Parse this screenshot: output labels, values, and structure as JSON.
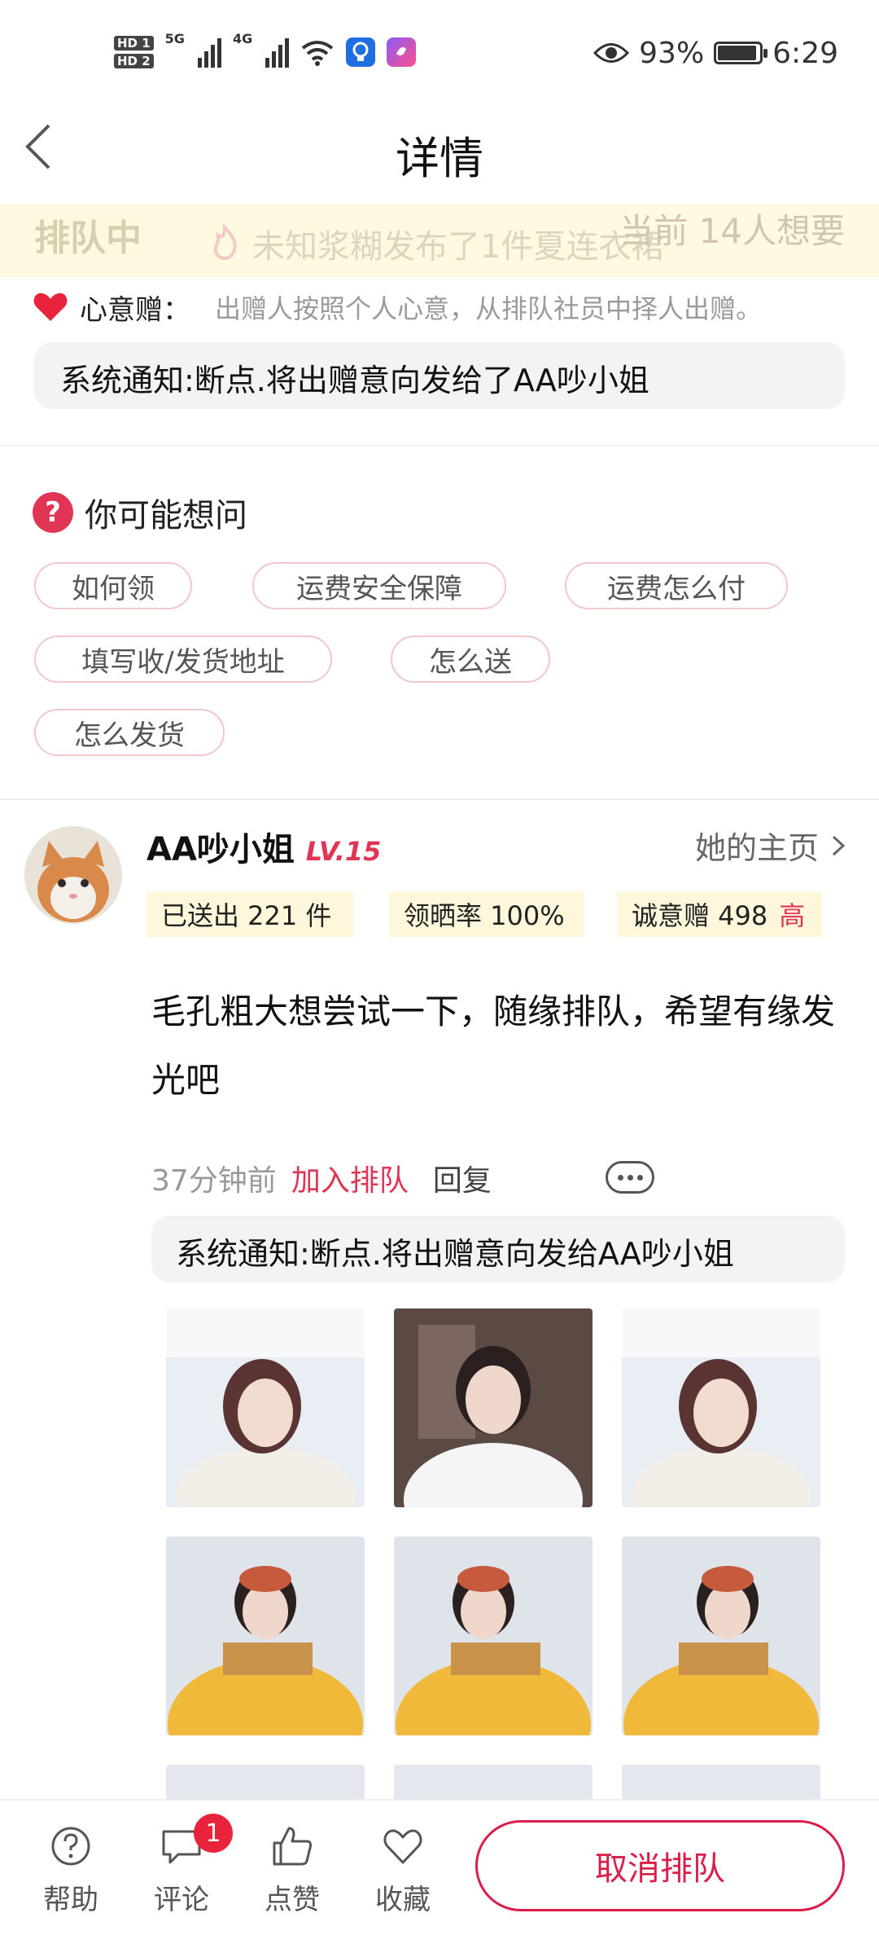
{
  "status_bar": {
    "hd1": "HD 1",
    "hd2": "HD 2",
    "net1": "5G",
    "net2": "4G",
    "battery_pct": "93%",
    "battery_level": 0.93,
    "time": "6:29"
  },
  "header": {
    "title": "详情"
  },
  "banner": {
    "status": "排队中",
    "ticker": "未知浆糊发布了1件夏连衣裙",
    "count": "当前 14人想要"
  },
  "gift": {
    "label": "心意赠：",
    "desc": "出赠人按照个人心意，从排队社员中择人出赠。"
  },
  "notice_top": "系统通知:断点.将出赠意向发给了AA吵小姐",
  "faq": {
    "title": "你可能想问",
    "chips": [
      "如何领",
      "运费安全保障",
      "运费怎么付",
      "填写收/发货地址",
      "怎么送",
      "怎么发货"
    ]
  },
  "user": {
    "name": "AA吵小姐",
    "level": "LV.15",
    "homepage": "她的主页",
    "stats": {
      "sent": "已送出 221 件",
      "rate": "领晒率 100%",
      "sincere": "诚意赠 498",
      "sincere_tag": "高"
    }
  },
  "post": {
    "text": "毛孔粗大想尝试一下，随缘排队，希望有缘发光吧",
    "time": "37分钟前",
    "action": "加入排队",
    "reply": "回复",
    "notice": "系统通知:断点.将出赠意向发给AA吵小姐"
  },
  "bottom": {
    "help": "帮助",
    "comment": "评论",
    "comment_badge": "1",
    "like": "点赞",
    "fav": "收藏",
    "cancel": "取消排队"
  },
  "colors": {
    "accent": "#e03555",
    "banner_bg": "#fff9e0",
    "stat_bg": "#fff7dc"
  }
}
